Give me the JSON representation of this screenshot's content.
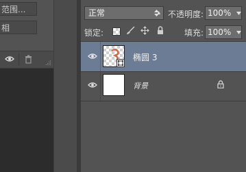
{
  "left_panel": {
    "button1_label": "范围...",
    "button2_label": "相"
  },
  "layers_panel": {
    "blend_mode": "正常",
    "opacity_label": "不透明度:",
    "opacity_value": "100%",
    "lock_label": "锁定:",
    "fill_label": "填充:",
    "fill_value": "100%",
    "layers": [
      {
        "name": "椭圆 3",
        "selected": true
      },
      {
        "name": "背景",
        "selected": false,
        "locked": true
      }
    ]
  },
  "colors": {
    "panel_bg": "#535353",
    "selected_row": "#6b7c94",
    "shape_color": "#d0674a"
  }
}
